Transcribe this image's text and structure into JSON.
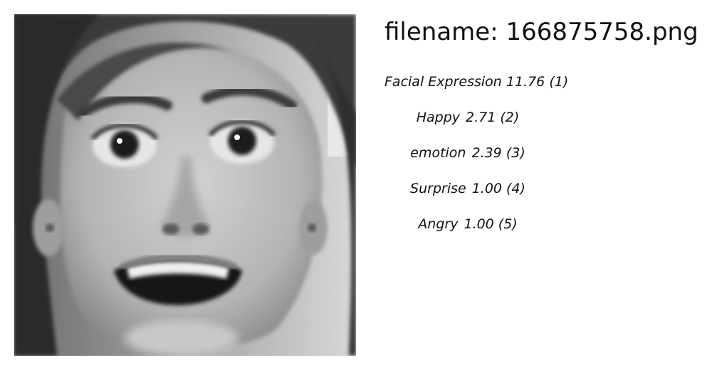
{
  "image": {
    "subject": "grayscale-face-photo"
  },
  "filename": {
    "label": "filename:",
    "value": "166875758.png"
  },
  "labels": [
    {
      "name": "Facial Expression",
      "score": "11.76",
      "rank": "(1)"
    },
    {
      "name": "Happy",
      "score": "2.71",
      "rank": "(2)"
    },
    {
      "name": "emotion",
      "score": "2.39",
      "rank": "(3)"
    },
    {
      "name": "Surprise",
      "score": "1.00",
      "rank": "(4)"
    },
    {
      "name": "Angry",
      "score": "1.00",
      "rank": "(5)"
    }
  ]
}
